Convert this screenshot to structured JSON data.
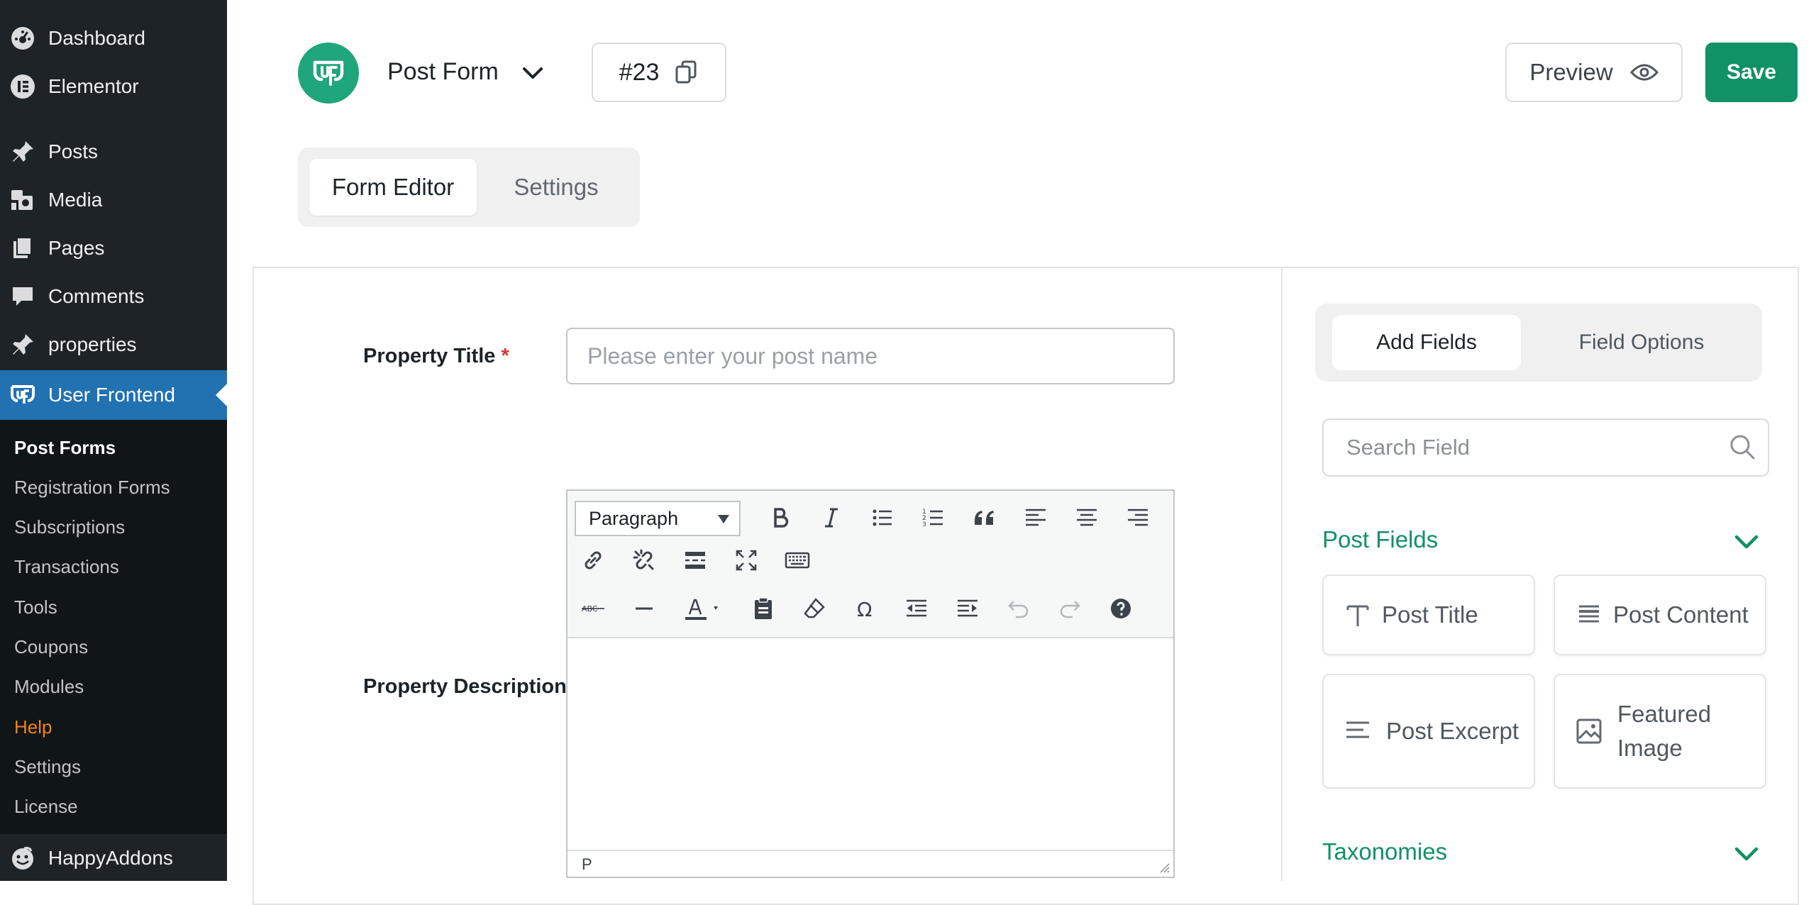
{
  "sidebar": {
    "items": [
      {
        "label": "Dashboard",
        "icon": "dashboard-icon"
      },
      {
        "label": "Elementor",
        "icon": "elementor-icon"
      },
      {
        "label": "Posts",
        "icon": "pin-icon"
      },
      {
        "label": "Media",
        "icon": "media-icon"
      },
      {
        "label": "Pages",
        "icon": "pages-icon"
      },
      {
        "label": "Comments",
        "icon": "comments-icon"
      },
      {
        "label": "properties",
        "icon": "pin-icon"
      },
      {
        "label": "User Frontend",
        "icon": "user-frontend-icon",
        "active": true
      },
      {
        "label": "HappyAddons",
        "icon": "happyaddons-icon"
      }
    ],
    "submenu": [
      {
        "label": "Post Forms",
        "current": true
      },
      {
        "label": "Registration Forms"
      },
      {
        "label": "Subscriptions"
      },
      {
        "label": "Transactions"
      },
      {
        "label": "Tools"
      },
      {
        "label": "Coupons"
      },
      {
        "label": "Modules"
      },
      {
        "label": "Help"
      },
      {
        "label": "Settings"
      },
      {
        "label": "License"
      }
    ]
  },
  "header": {
    "form_name": "Post Form",
    "form_id": "#23",
    "preview_label": "Preview",
    "save_label": "Save"
  },
  "editor_tabs": [
    "Form Editor",
    "Settings"
  ],
  "form": {
    "title_label": "Property Title",
    "required_mark": "*",
    "title_placeholder": "Please enter your post name",
    "description_label": "Property Description",
    "format_select": "Paragraph",
    "status_path": "P"
  },
  "right_panel": {
    "tabs": [
      "Add Fields",
      "Field Options"
    ],
    "search_placeholder": "Search Field",
    "post_fields_title": "Post Fields",
    "fields": [
      {
        "label": "Post Title",
        "icon": "text-icon"
      },
      {
        "label": "Post Content",
        "icon": "content-icon"
      },
      {
        "label": "Post Excerpt",
        "icon": "excerpt-icon"
      },
      {
        "label": "Featured Image",
        "icon": "image-icon"
      }
    ],
    "taxonomies_title": "Taxonomies"
  },
  "colors": {
    "accent_green": "#119166",
    "wp_admin_bg": "#1d2327",
    "wp_active_blue": "#2271b1",
    "help_orange": "#f0821a"
  }
}
